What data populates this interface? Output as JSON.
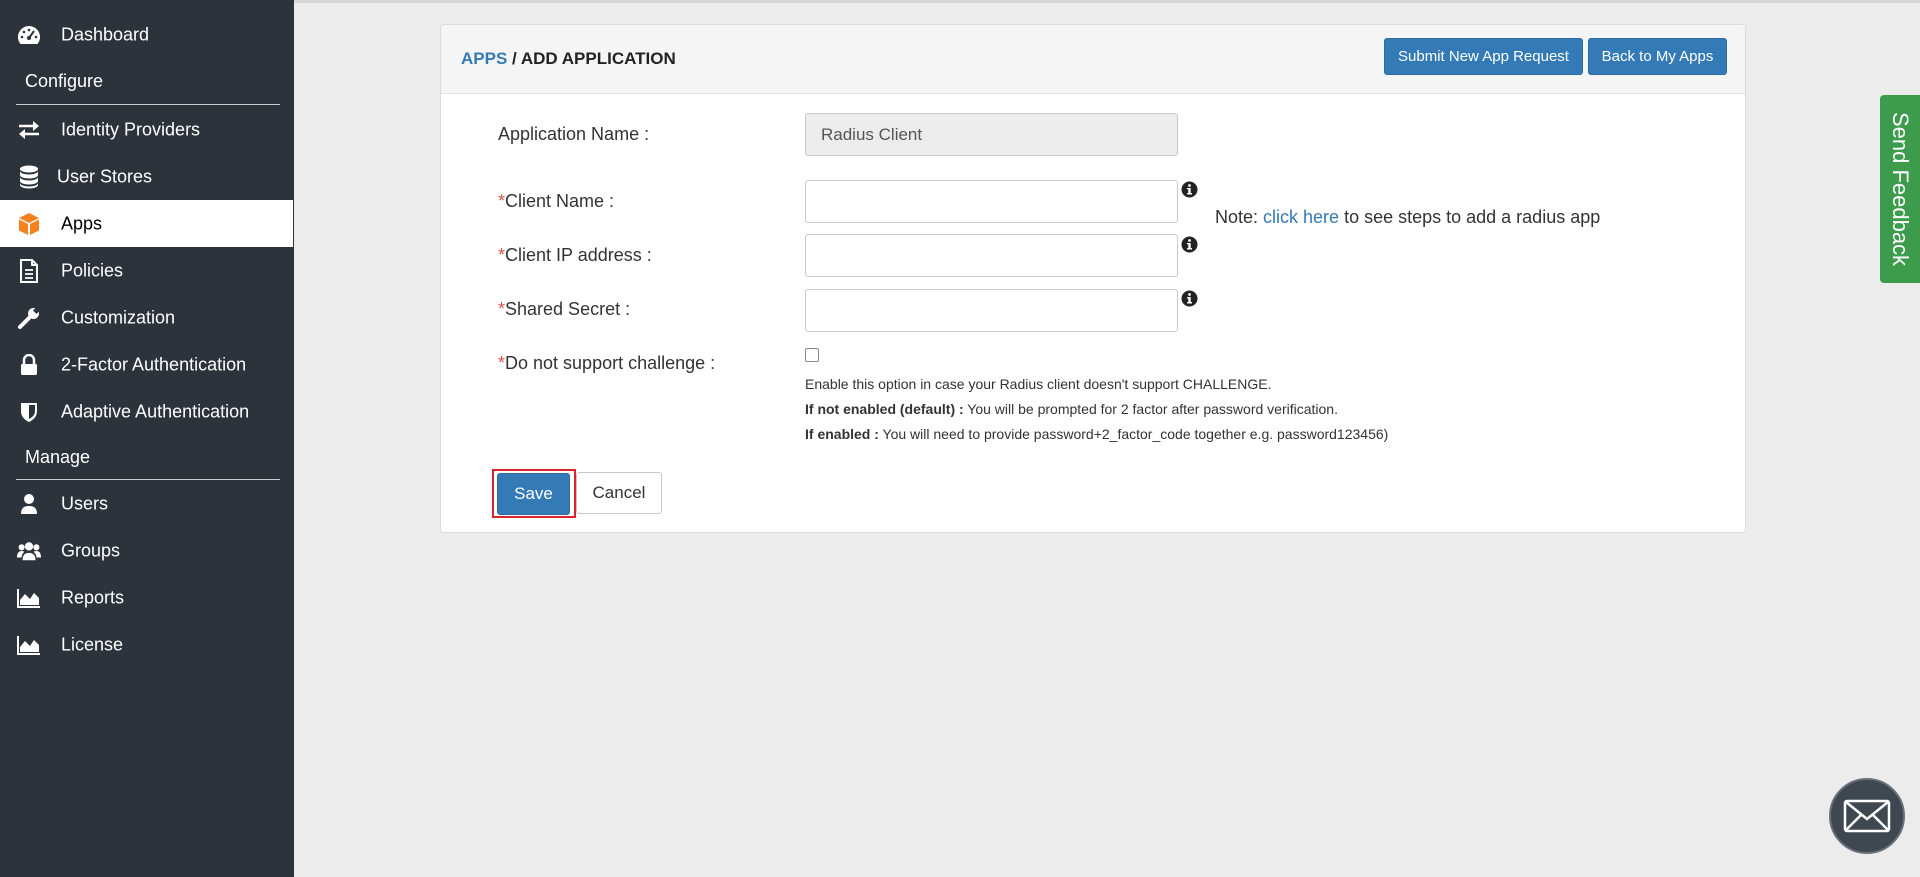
{
  "sidebar": {
    "items": [
      {
        "label": "Dashboard",
        "icon": "dashboard-icon"
      },
      {
        "label": "Identity Providers",
        "icon": "arrows-exchange-icon"
      },
      {
        "label": "User Stores",
        "icon": "database-icon"
      },
      {
        "label": "Apps",
        "icon": "cube-icon"
      },
      {
        "label": "Policies",
        "icon": "document-icon"
      },
      {
        "label": "Customization",
        "icon": "wrench-icon"
      },
      {
        "label": "2-Factor Authentication",
        "icon": "lock-icon"
      },
      {
        "label": "Adaptive Authentication",
        "icon": "shield-icon"
      },
      {
        "label": "Users",
        "icon": "user-icon"
      },
      {
        "label": "Groups",
        "icon": "users-group-icon"
      },
      {
        "label": "Reports",
        "icon": "area-chart-icon"
      },
      {
        "label": "License",
        "icon": "area-chart-icon"
      }
    ],
    "sections": {
      "configure": "Configure",
      "manage": "Manage"
    },
    "active": "Apps",
    "accent_color": "#f5821f"
  },
  "header": {
    "crumb_link": "APPS",
    "crumb_sep": " / ",
    "crumb_current": "ADD APPLICATION",
    "submit_label": "Submit New App Request",
    "back_label": "Back to My Apps"
  },
  "form": {
    "app_name_label": "Application Name :",
    "app_name_value": "Radius Client",
    "client_name_label": "Client Name :",
    "client_ip_label": "Client IP address :",
    "shared_secret_label": "Shared Secret :",
    "challenge_label": "Do not support challenge :",
    "required_mark": "*",
    "note_prefix": "Note: ",
    "note_link": "click here",
    "note_suffix": " to see steps to add a radius app",
    "help_line1": "Enable this option in case your Radius client doesn't support CHALLENGE.",
    "help_line2_bold": "If not enabled (default) :",
    "help_line2_text": " You will be prompted for 2 factor after password verification.",
    "help_line3_bold": "If enabled :",
    "help_line3_text": " You will need to provide password+2_factor_code together e.g. password123456)",
    "save_label": "Save",
    "cancel_label": "Cancel"
  },
  "feedback": {
    "label": "Send Feedback"
  },
  "colors": {
    "primary": "#337ab7",
    "sidebar_bg": "#2d333b",
    "feedback_green": "#3c9c4c",
    "required": "#d9534f"
  }
}
